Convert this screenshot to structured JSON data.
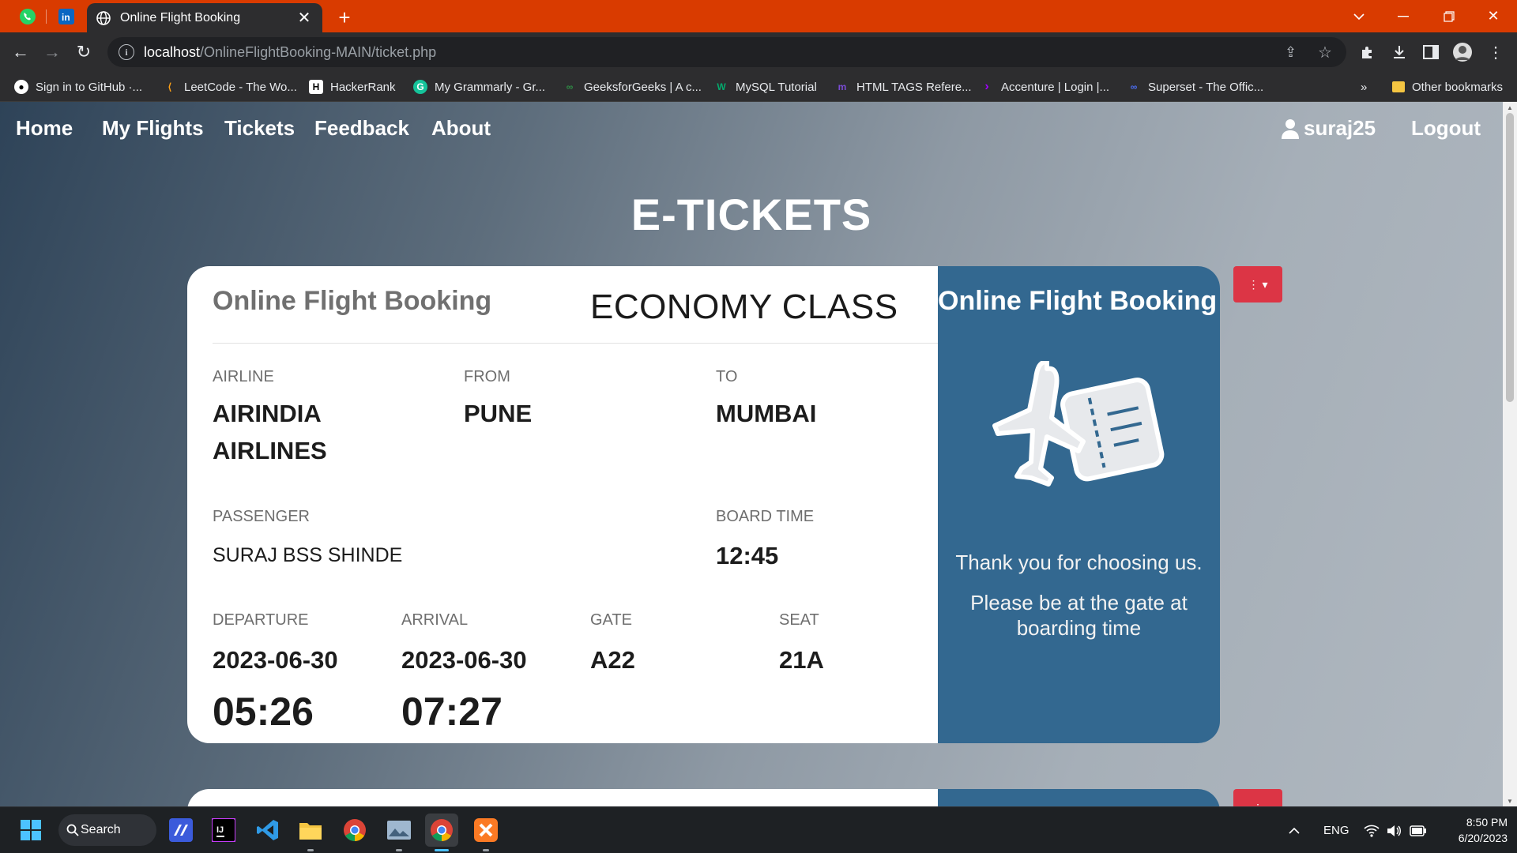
{
  "browser": {
    "tab_title": "Online Flight Booking",
    "url_host": "localhost",
    "url_path": "/OnlineFlightBooking-MAIN/ticket.php",
    "accent_color": "#d93b00"
  },
  "bookmarks": [
    {
      "label": "Sign in to GitHub ·...",
      "icon": "github-icon"
    },
    {
      "label": "LeetCode - The Wo...",
      "icon": "leetcode-icon"
    },
    {
      "label": "HackerRank",
      "icon": "hackerrank-icon"
    },
    {
      "label": "My Grammarly - Gr...",
      "icon": "grammarly-icon"
    },
    {
      "label": "GeeksforGeeks | A c...",
      "icon": "gfg-icon"
    },
    {
      "label": "MySQL Tutorial",
      "icon": "w3-icon"
    },
    {
      "label": "HTML TAGS Refere...",
      "icon": "m-icon"
    },
    {
      "label": "Accenture | Login |...",
      "icon": "accenture-icon"
    },
    {
      "label": "Superset - The Offic...",
      "icon": "superset-icon"
    }
  ],
  "bookmarks_more": "»",
  "bookmarks_other": "Other bookmarks",
  "nav": {
    "home": "Home",
    "my_flights": "My Flights",
    "tickets": "Tickets",
    "feedback": "Feedback",
    "about": "About",
    "user": "suraj25",
    "logout": "Logout"
  },
  "heading": "E-TICKETS",
  "ticket": {
    "brand": "Online Flight Booking",
    "class": "ECONOMY CLASS",
    "airline_label": "AIRLINE",
    "airline_line1": "AIRINDIA",
    "airline_line2": "AIRLINES",
    "from_label": "FROM",
    "from": "PUNE",
    "to_label": "TO",
    "to": "MUMBAI",
    "passenger_label": "PASSENGER",
    "passenger": "SURAJ BSS SHINDE",
    "board_time_label": "BOARD TIME",
    "board_time": "12:45",
    "departure_label": "DEPARTURE",
    "departure_date": "2023-06-30",
    "departure_time": "05:26",
    "arrival_label": "ARRIVAL",
    "arrival_date": "2023-06-30",
    "arrival_time": "07:27",
    "gate_label": "GATE",
    "gate": "A22",
    "seat_label": "SEAT",
    "seat": "21A",
    "stub_title": "Online Flight Booking",
    "stub_thanks": "Thank you for choosing us.",
    "stub_note": "Please be at the gate at boarding time",
    "stub_color": "#336890"
  },
  "taskbar": {
    "search": "Search",
    "lang": "ENG",
    "time": "8:50 PM",
    "date": "6/20/2023"
  }
}
